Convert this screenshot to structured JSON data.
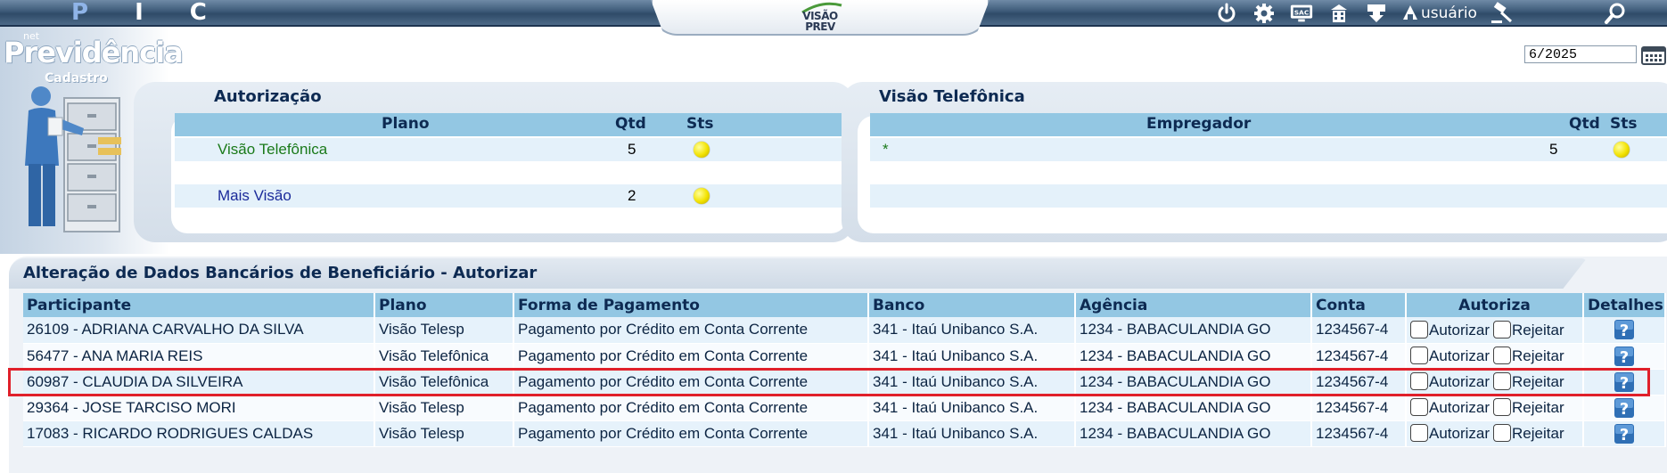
{
  "app": {
    "nav_letters": [
      "P",
      "I",
      "C"
    ],
    "logo_line1": "VISÃO",
    "logo_line2": "PREV",
    "user_label": "usuário",
    "brand_prefix": "net",
    "brand_name": "Previdência",
    "module": "Cadastro",
    "period": "6/2025"
  },
  "icons": {
    "power": "power-icon",
    "settings": "gear-icon",
    "sac": "sac-icon",
    "building": "building-icon",
    "download": "download-icon",
    "judge": "gavel-icon",
    "search": "search-icon",
    "calendar": "calendar-icon",
    "help": "help-icon"
  },
  "colors": {
    "header_blue": "#93c7e3",
    "title_navy": "#0d2a52",
    "status_yellow": "#f2e200",
    "plan_green": "#1a7a1a",
    "plan_blue": "#1a2a9a",
    "highlight_red": "#e0202a"
  },
  "autorizacao": {
    "title": "Autorização",
    "headers": {
      "plano": "Plano",
      "qtd": "Qtd",
      "sts": "Sts"
    },
    "rows": [
      {
        "plano": "Visão Telefônica",
        "qtd": "5",
        "status": "yellow"
      },
      {
        "plano": "Mais Visão",
        "qtd": "2",
        "status": "yellow"
      }
    ]
  },
  "visao_telefonica": {
    "title": "Visão Telefônica",
    "headers": {
      "empregador": "Empregador",
      "qtd": "Qtd",
      "sts": "Sts"
    },
    "rows": [
      {
        "empregador": "*",
        "qtd": "5",
        "status": "yellow"
      }
    ]
  },
  "alteracao": {
    "title": "Alteração de Dados Bancários de Beneficiário - Autorizar",
    "headers": {
      "participante": "Participante",
      "plano": "Plano",
      "forma": "Forma de Pagamento",
      "banco": "Banco",
      "agencia": "Agência",
      "conta": "Conta",
      "autoriza": "Autoriza",
      "detalhes": "Detalhes"
    },
    "autorizar_label": "Autorizar",
    "rejeitar_label": "Rejeitar",
    "rows": [
      {
        "participante": "26109 - ADRIANA CARVALHO DA SILVA",
        "plano": "Visão Telesp",
        "forma": "Pagamento por Crédito em Conta Corrente",
        "banco": "341 - Itaú Unibanco S.A.",
        "agencia": "1234 - BABACULANDIA GO",
        "conta": "1234567-4"
      },
      {
        "participante": "56477 - ANA MARIA REIS",
        "plano": "Visão Telefônica",
        "forma": "Pagamento por Crédito em Conta Corrente",
        "banco": "341 - Itaú Unibanco S.A.",
        "agencia": "1234 - BABACULANDIA GO",
        "conta": "1234567-4"
      },
      {
        "participante": "60987 - CLAUDIA DA SILVEIRA",
        "plano": "Visão Telefônica",
        "forma": "Pagamento por Crédito em Conta Corrente",
        "banco": "341 - Itaú Unibanco S.A.",
        "agencia": "1234 - BABACULANDIA GO",
        "conta": "1234567-4"
      },
      {
        "participante": "29364 - JOSE TARCISO MORI",
        "plano": "Visão Telesp",
        "forma": "Pagamento por Crédito em Conta Corrente",
        "banco": "341 - Itaú Unibanco S.A.",
        "agencia": "1234 - BABACULANDIA GO",
        "conta": "1234567-4"
      },
      {
        "participante": "17083 - RICARDO RODRIGUES CALDAS",
        "plano": "Visão Telesp",
        "forma": "Pagamento por Crédito em Conta Corrente",
        "banco": "341 - Itaú Unibanco S.A.",
        "agencia": "1234 - BABACULANDIA GO",
        "conta": "1234567-4"
      }
    ]
  }
}
